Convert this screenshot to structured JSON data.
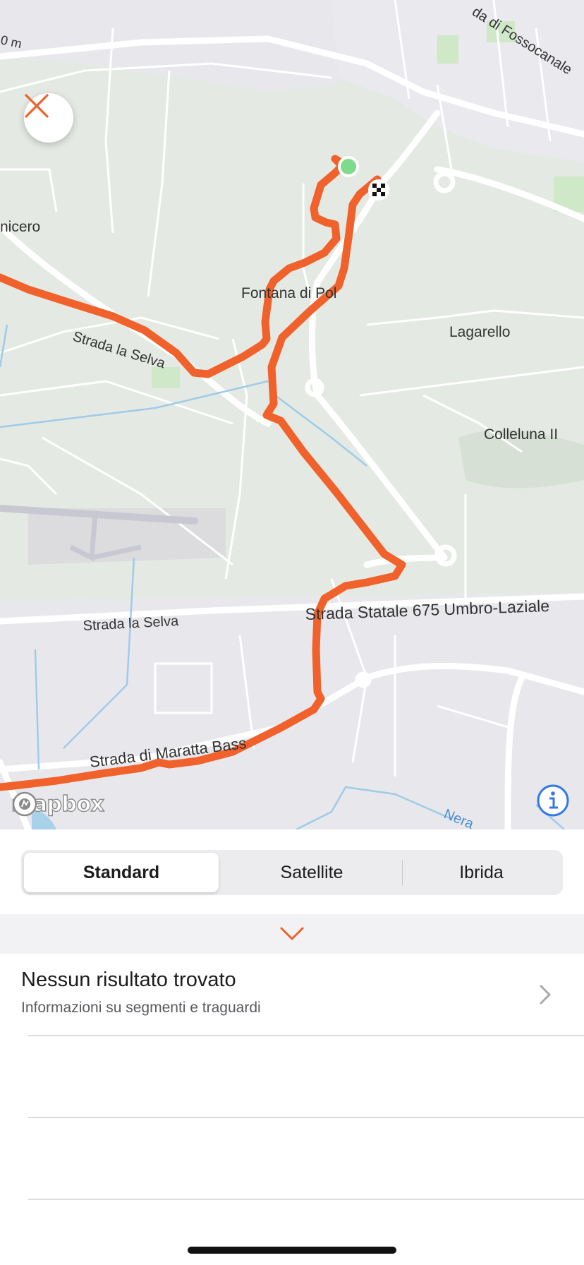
{
  "map": {
    "place_labels": [
      "nicero",
      "Fontana di Pol",
      "Lagarello",
      "Colleluna II"
    ],
    "road_labels": [
      "Strada la Selva",
      "Strada la Selva",
      "Strada Statale 675 Umbro-Laziale",
      "Strada di Maratta Bass",
      "da di Fossocanale",
      "Nera",
      "0 m"
    ],
    "attribution": "mapbox",
    "route_color": "#f0612b",
    "start_marker_color": "#7ddb8b"
  },
  "map_style": {
    "options": [
      "Standard",
      "Satellite",
      "Ibrida"
    ],
    "selected": "Standard"
  },
  "segments": {
    "title": "Nessun risultato trovato",
    "subtitle": "Informazioni su segmenti e traguardi"
  },
  "icons": {
    "close": "close-icon",
    "info": "info-icon",
    "collapse": "chevron-down-icon",
    "disclosure": "chevron-right-icon"
  }
}
